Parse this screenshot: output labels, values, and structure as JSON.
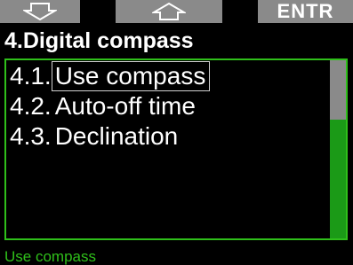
{
  "softkeys": {
    "left": {
      "icon": "arrow-down-icon"
    },
    "middle": {
      "icon": "arrow-up-icon"
    },
    "right": {
      "label": "ENTR"
    }
  },
  "title": "4.Digital compass",
  "menu": {
    "items": [
      {
        "number": "4.1.",
        "label": "Use compass",
        "selected": true
      },
      {
        "number": "4.2.",
        "label": "Auto-off time",
        "selected": false
      },
      {
        "number": "4.3.",
        "label": "Declination",
        "selected": false
      }
    ],
    "scroll_position": 0.33
  },
  "status": "Use compass",
  "colors": {
    "accent": "#2fbf1a",
    "softkey": "#8a8a8a",
    "background": "#000000"
  }
}
